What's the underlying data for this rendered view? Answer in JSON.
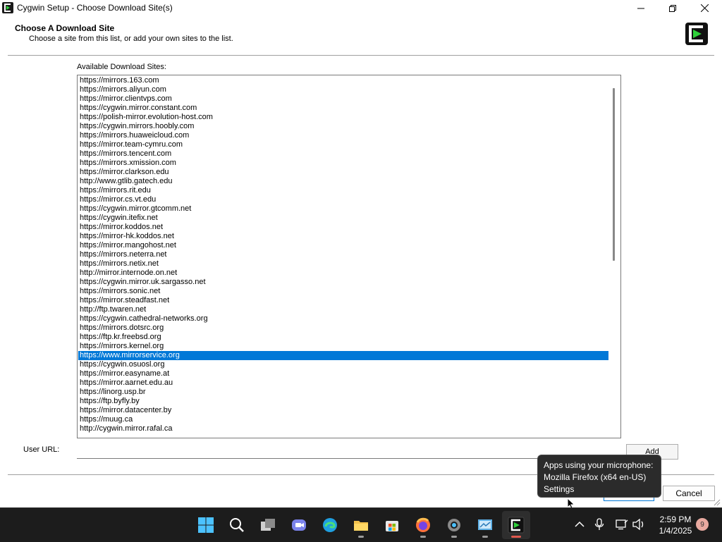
{
  "window": {
    "title": "Cygwin Setup - Choose Download Site(s)"
  },
  "header": {
    "title": "Choose A Download Site",
    "subtitle": "Choose a site from this list, or add your own sites to the list."
  },
  "sites_label": "Available Download Sites:",
  "selected_index": 30,
  "sites": [
    "https://mirrors.163.com",
    "https://mirrors.aliyun.com",
    "https://mirror.clientvps.com",
    "https://cygwin.mirror.constant.com",
    "https://polish-mirror.evolution-host.com",
    "https://cygwin.mirrors.hoobly.com",
    "https://mirrors.huaweicloud.com",
    "https://mirror.team-cymru.com",
    "https://mirrors.tencent.com",
    "https://mirrors.xmission.com",
    "https://mirror.clarkson.edu",
    "http://www.gtlib.gatech.edu",
    "https://mirrors.rit.edu",
    "https://mirror.cs.vt.edu",
    "https://cygwin.mirror.gtcomm.net",
    "https://cygwin.itefix.net",
    "https://mirror.koddos.net",
    "https://mirror-hk.koddos.net",
    "https://mirror.mangohost.net",
    "https://mirrors.neterra.net",
    "https://mirrors.netix.net",
    "http://mirror.internode.on.net",
    "https://cygwin.mirror.uk.sargasso.net",
    "https://mirrors.sonic.net",
    "https://mirror.steadfast.net",
    "http://ftp.twaren.net",
    "https://cygwin.cathedral-networks.org",
    "https://mirrors.dotsrc.org",
    "https://ftp.kr.freebsd.org",
    "https://mirrors.kernel.org",
    "https://www.mirrorservice.org",
    "https://cygwin.osuosl.org",
    "https://mirror.easyname.at",
    "https://mirror.aarnet.edu.au",
    "https://linorg.usp.br",
    "https://ftp.byfly.by",
    "https://mirror.datacenter.by",
    "https://muug.ca",
    "http://cygwin.mirror.rafal.ca"
  ],
  "user_url": {
    "label": "User URL:",
    "value": "",
    "add_label": "Add"
  },
  "buttons": {
    "next_label": "",
    "cancel_label": "Cancel"
  },
  "tooltip": {
    "line1": "Apps using your microphone:",
    "line2": "Mozilla Firefox (x64 en-US)",
    "line3": "Settings"
  },
  "taskbar": {
    "apps": [
      "start-icon",
      "search-icon",
      "task-view-icon",
      "teams-icon",
      "edge-icon",
      "file-explorer-icon",
      "store-icon",
      "firefox-icon",
      "settings-icon",
      "control-panel-icon",
      "cygwin-icon"
    ],
    "time": "2:59 PM",
    "date": "1/4/2025",
    "notification_count": "9"
  },
  "colors": {
    "selection": "#0078d7",
    "taskbar": "#1c1c1c",
    "cygwin_green": "#2fd03a"
  }
}
